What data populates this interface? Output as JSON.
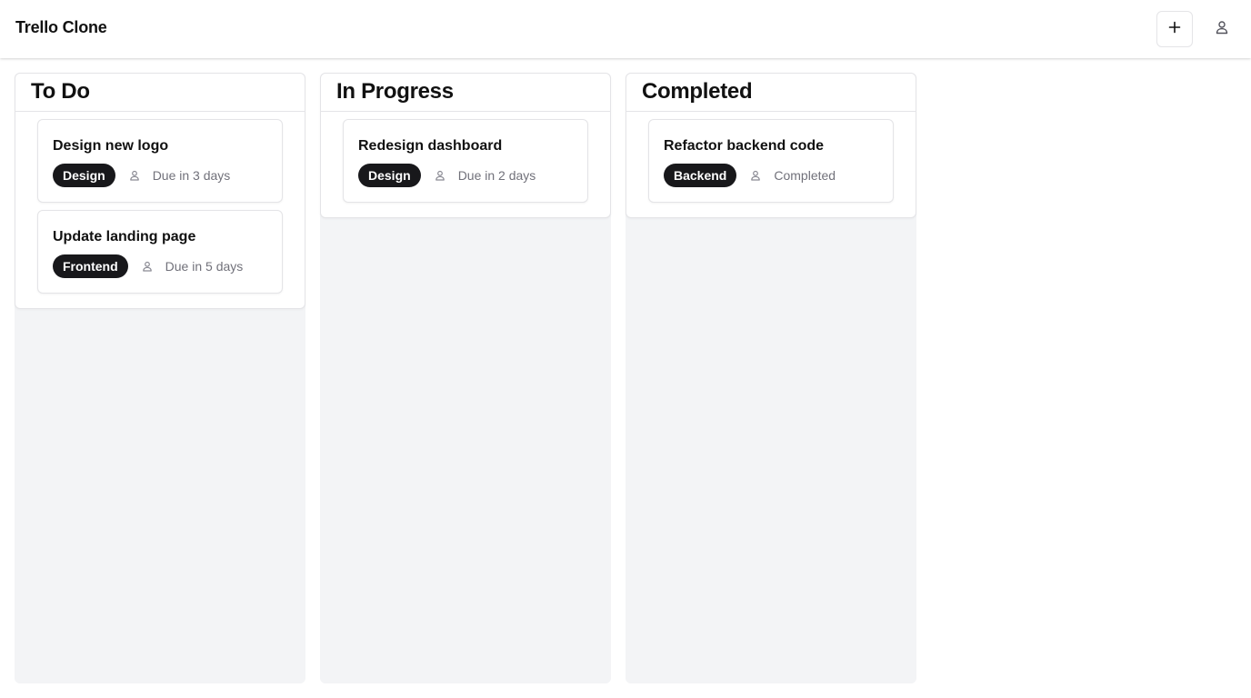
{
  "header": {
    "title": "Trello Clone",
    "add_icon": "plus-icon",
    "profile_icon": "user-icon"
  },
  "colors": {
    "tag_background": "#18181b",
    "column_background": "#f3f4f6",
    "muted_text": "#71717a"
  },
  "columns": [
    {
      "title": "To Do",
      "cards": [
        {
          "title": "Design new logo",
          "tag": "Design",
          "meta": "Due in 3 days"
        },
        {
          "title": "Update landing page",
          "tag": "Frontend",
          "meta": "Due in 5 days"
        }
      ]
    },
    {
      "title": "In Progress",
      "cards": [
        {
          "title": "Redesign dashboard",
          "tag": "Design",
          "meta": "Due in 2 days"
        }
      ]
    },
    {
      "title": "Completed",
      "cards": [
        {
          "title": "Refactor backend code",
          "tag": "Backend",
          "meta": "Completed"
        }
      ]
    }
  ]
}
